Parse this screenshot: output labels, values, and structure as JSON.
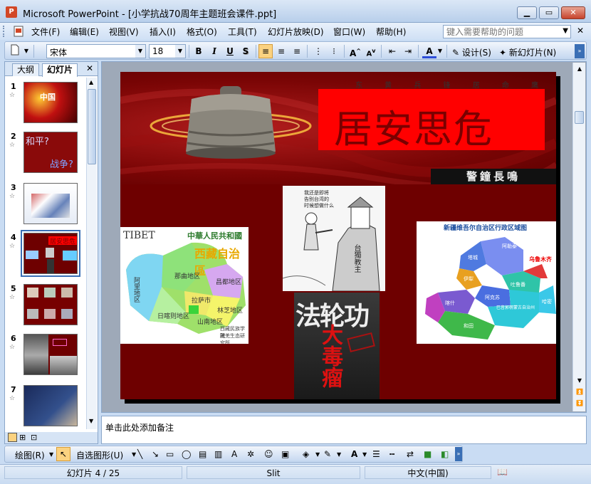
{
  "window": {
    "title": "Microsoft PowerPoint - [小学抗战70周年主题班会课件.ppt]",
    "app_icon_letter": "P",
    "min_label": "▁",
    "max_label": "▭",
    "close_label": "✕"
  },
  "menu": {
    "items": [
      "文件(F)",
      "编辑(E)",
      "视图(V)",
      "插入(I)",
      "格式(O)",
      "工具(T)",
      "幻灯片放映(D)",
      "窗口(W)",
      "帮助(H)"
    ],
    "help_placeholder": "键入需要帮助的问题",
    "close_label": "✕"
  },
  "toolbar": {
    "font_name": "宋体",
    "font_size": "18",
    "bold": "B",
    "italic": "I",
    "underline": "U",
    "shadow": "S",
    "font_color": "A",
    "design_label": "设计(S)",
    "new_slide_label": "新幻灯片(N)"
  },
  "left_pane": {
    "tab_outline": "大纲",
    "tab_slides": "幻灯片",
    "close_label": "✕",
    "selected_slide": 4,
    "slides": [
      {
        "num": "1",
        "star": "☆",
        "thumb_text": "中国"
      },
      {
        "num": "2",
        "star": "☆",
        "thumb_text": "和平?",
        "thumb_text2": "战争?"
      },
      {
        "num": "3",
        "star": "☆",
        "thumb_text": ""
      },
      {
        "num": "4",
        "star": "☆",
        "thumb_text": "居安思危"
      },
      {
        "num": "5",
        "star": "☆",
        "thumb_text": ""
      },
      {
        "num": "6",
        "star": "☆",
        "thumb_text": ""
      },
      {
        "num": "7",
        "star": "☆",
        "thumb_text": ""
      }
    ]
  },
  "slide": {
    "banner_small_text": "东 黄 兵 锋 居 命 鹰",
    "title": "居安思危",
    "motto": "警鐘長鳴",
    "tibet_map": {
      "label_en": "TIBET",
      "title_line1": "中華人民共和國",
      "title_line2": "西藏自治區",
      "regions": [
        "阿里地区",
        "那曲地区",
        "昌都地区",
        "日喀则地区",
        "拉萨市",
        "林芝地区",
        "山南地区"
      ],
      "footer": [
        "西藏民族学院",
        "藏羌生态研究所"
      ]
    },
    "cartoon": {
      "caption": "台獨教主",
      "speech": "我还是即将\n告别台湾的\n时候想做什么"
    },
    "falungong": {
      "title": "法轮功",
      "sub": "大毒瘤"
    },
    "xinjiang_map": {
      "title": "新疆维吾尔自治区行政区域图",
      "labels": [
        "阿勒泰",
        "塔城",
        "乌鲁木齐",
        "伊犁",
        "吐鲁番",
        "哈密",
        "阿克苏",
        "喀什",
        "和田",
        "巴音郭楞蒙古自治州"
      ]
    }
  },
  "notes_placeholder": "单击此处添加备注",
  "drawing": {
    "draw_label": "绘图(R)",
    "autoshapes_label": "自选图形(U)"
  },
  "status": {
    "slide_info": "幻灯片 4 / 25",
    "design": "Slit",
    "language": "中文(中国)"
  },
  "colors": {
    "accent": "#3a6fb5",
    "slide_bg": "#6e0000",
    "title_box": "#ff0000"
  }
}
